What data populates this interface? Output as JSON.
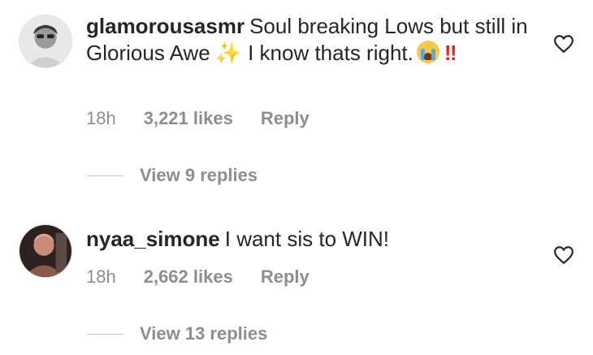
{
  "comments": [
    {
      "username": "glamorousasmr",
      "text_part1": "Soul breaking Lows but still in Glorious Awe",
      "text_part2": "I know thats right.",
      "emoji_sparkles": "✨",
      "emoji_bang": "‼",
      "time": "18h",
      "likes": "3,221 likes",
      "reply": "Reply",
      "view_replies": "View 9 replies"
    },
    {
      "username": "nyaa_simone",
      "text": "I want sis to WIN!",
      "time": "18h",
      "likes": "2,662 likes",
      "reply": "Reply",
      "view_replies": "View 13 replies"
    }
  ],
  "icons": {
    "like": "heart-icon",
    "emoji_cry": "loudly-crying-face-icon"
  },
  "colors": {
    "text": "#262626",
    "secondary": "#8e8e8e",
    "divider": "#c7c7c7"
  }
}
